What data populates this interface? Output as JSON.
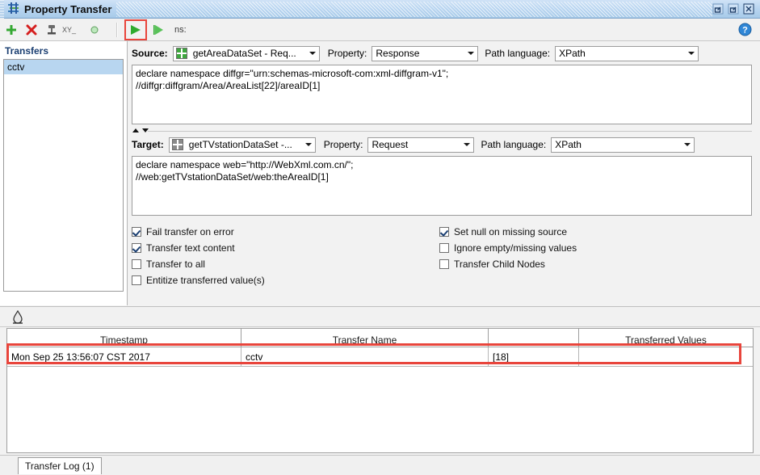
{
  "window": {
    "title": "Property Transfer",
    "title_icon": "property-transfer-icon",
    "buttons": [
      {
        "name": "restore-down-button",
        "glyph": "restore"
      },
      {
        "name": "maximize-button",
        "glyph": "maximize"
      },
      {
        "name": "close-button",
        "glyph": "close"
      }
    ]
  },
  "toolbar": {
    "add_label": "+",
    "delete_label": "✕",
    "rename_icon": "rename-icon",
    "xy_label": "XY_",
    "disabled_icon": "toggle-disabled-icon",
    "run_icon": "run-icon",
    "run_step_icon": "run-step-icon",
    "ns_label": "ns:",
    "help_icon": "help-icon"
  },
  "sidebar": {
    "title": "Transfers",
    "items": [
      {
        "label": "cctv",
        "selected": true
      }
    ]
  },
  "source": {
    "label": "Source:",
    "combo_value": "getAreaDataSet - Req...",
    "combo_icon": "datasource-green-icon",
    "property_label": "Property:",
    "property_value": "Response",
    "path_language_label": "Path language:",
    "path_language_value": "XPath",
    "expression": "declare namespace diffgr=\"urn:schemas-microsoft-com:xml-diffgram-v1\";\n//diffgr:diffgram/Area/AreaList[22]/areaID[1]"
  },
  "target": {
    "label": "Target:",
    "combo_value": "getTVstationDataSet -...",
    "combo_icon": "datasource-gray-icon",
    "property_label": "Property:",
    "property_value": "Request",
    "path_language_label": "Path language:",
    "path_language_value": "XPath",
    "expression": "declare namespace web=\"http://WebXml.com.cn/\";\n//web:getTVstationDataSet/web:theAreaID[1]"
  },
  "options": {
    "left": [
      {
        "label": "Fail transfer on error",
        "checked": true
      },
      {
        "label": "Transfer text content",
        "checked": true
      },
      {
        "label": "Transfer to all",
        "checked": false
      },
      {
        "label": "Entitize transferred value(s)",
        "checked": false
      }
    ],
    "right": [
      {
        "label": "Set null on missing source",
        "checked": true
      },
      {
        "label": "Ignore empty/missing values",
        "checked": false
      },
      {
        "label": "Transfer Child Nodes",
        "checked": false
      }
    ]
  },
  "log": {
    "clear_icon": "clear-log-icon",
    "columns": [
      "Timestamp",
      "Transfer Name",
      "",
      "Transferred Values"
    ],
    "rows": [
      {
        "timestamp": "Mon Sep 25 13:56:07 CST 2017",
        "transfer_name": "cctv",
        "narrow": "[18]",
        "transferred_values": ""
      }
    ]
  },
  "bottom": {
    "tab_label": "Transfer Log (1)"
  },
  "colors": {
    "accent_blue": "#b7d4f0",
    "highlight_red": "#e8453c",
    "selection_blue": "#b8d6f0",
    "green": "#3fa73f"
  }
}
